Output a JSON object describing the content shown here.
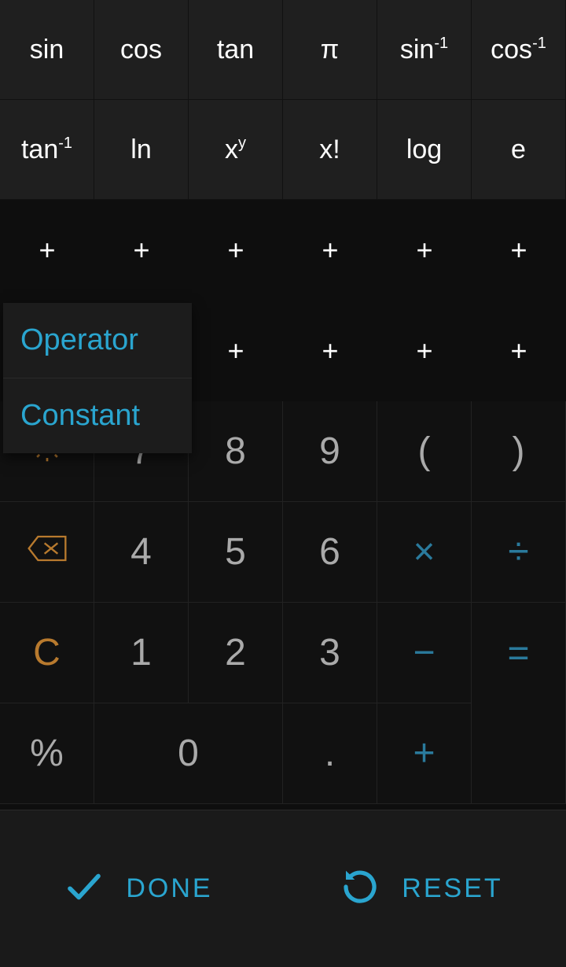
{
  "sci_row1": [
    {
      "html": "sin"
    },
    {
      "html": "cos"
    },
    {
      "html": "tan"
    },
    {
      "html": "π"
    },
    {
      "html": "sin<sup>-1</sup>"
    },
    {
      "html": "cos<sup>-1</sup>"
    }
  ],
  "sci_row2": [
    {
      "html": "tan<sup>-1</sup>"
    },
    {
      "html": "ln"
    },
    {
      "html": "x<sup>y</sup>"
    },
    {
      "html": "x!"
    },
    {
      "html": "log"
    },
    {
      "html": "e"
    }
  ],
  "slots_row1": [
    "+",
    "+",
    "+",
    "+",
    "+",
    "+"
  ],
  "slots_row2": [
    "",
    "",
    "+",
    "+",
    "+",
    "+"
  ],
  "keypad": {
    "r1": [
      "gear",
      "7",
      "8",
      "9",
      "(",
      ")"
    ],
    "r2": [
      "back",
      "4",
      "5",
      "6",
      "×",
      "÷"
    ],
    "r3": [
      "C",
      "1",
      "2",
      "3",
      "−",
      "="
    ],
    "r4": [
      "%",
      "0",
      "",
      ".",
      "+",
      ""
    ]
  },
  "popup": {
    "operator": "Operator",
    "constant": "Constant"
  },
  "bottom": {
    "done": "DONE",
    "reset": "RESET"
  }
}
